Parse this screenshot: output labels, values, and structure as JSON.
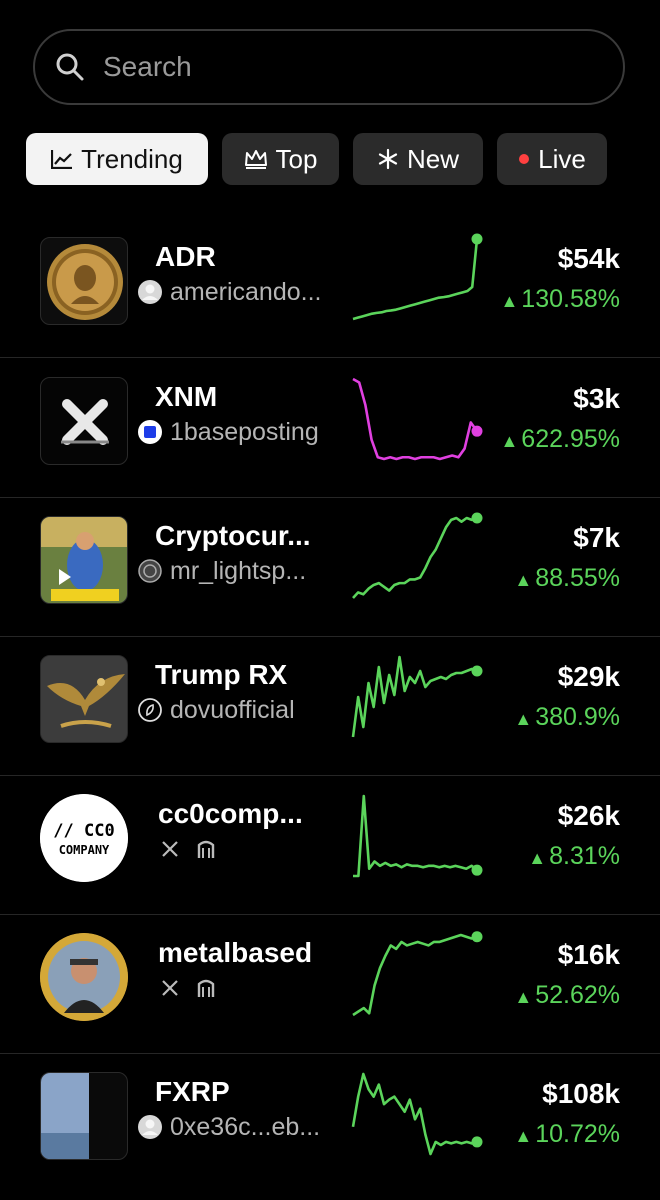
{
  "search": {
    "placeholder": "Search"
  },
  "tabs": [
    {
      "label": "Trending",
      "icon": "trending-chart-icon",
      "active": true
    },
    {
      "label": "Top",
      "icon": "crown-icon",
      "active": false
    },
    {
      "label": "New",
      "icon": "asterisk-icon",
      "active": false
    },
    {
      "label": "Live",
      "icon": "live-dot-icon",
      "active": false,
      "dot_color": "#ff4040"
    }
  ],
  "colors": {
    "up": "#5bd45b",
    "accent_pink": "#e040e0",
    "tab_bg": "#2b2b2b"
  },
  "tokens": [
    {
      "name": "ADR",
      "creator": "americando...",
      "creator_icon": "avatar-placeholder-icon",
      "price": "$54k",
      "change": "130.58%",
      "spark_color": "#5bd45b",
      "spark": [
        10,
        10.5,
        11,
        11.5,
        12,
        12.3,
        12.5,
        13,
        13.2,
        13.5,
        14,
        14.5,
        15,
        15.5,
        16,
        16.5,
        17,
        17.5,
        18,
        18.2,
        18.5,
        19,
        19.5,
        20,
        20.5,
        22,
        40
      ]
    },
    {
      "name": "XNM",
      "creator": "1baseposting",
      "creator_icon": "blue-square-icon",
      "price": "$3k",
      "change": "622.95%",
      "spark_color": "#e040e0",
      "spark": [
        60,
        58,
        45,
        25,
        15,
        14,
        15,
        14,
        15,
        15,
        14,
        15,
        15,
        15,
        14,
        15,
        16,
        15,
        20,
        35,
        30
      ]
    },
    {
      "name": "Cryptocur...",
      "creator": "mr_lightsp...",
      "creator_icon": "coin-icon",
      "price": "$7k",
      "change": "88.55%",
      "spark_color": "#5bd45b",
      "spark": [
        12,
        15,
        14,
        17,
        19,
        20,
        18,
        16,
        19,
        20,
        20,
        22,
        22,
        23,
        28,
        34,
        38,
        44,
        50,
        54,
        55,
        53,
        55,
        54,
        55
      ]
    },
    {
      "name": "Trump RX",
      "creator": "dovuofficial",
      "creator_icon": "leaf-icon",
      "price": "$29k",
      "change": "380.9%",
      "spark_color": "#5bd45b",
      "spark": [
        5,
        25,
        10,
        32,
        20,
        40,
        22,
        36,
        26,
        45,
        28,
        35,
        32,
        38,
        30,
        33,
        34,
        35,
        34,
        36,
        37,
        37,
        38,
        39,
        38
      ]
    },
    {
      "name": "cc0comp...",
      "creator_icon": "x-icon",
      "second_icon": "gate-icon",
      "price": "$26k",
      "change": "8.31%",
      "spark_color": "#5bd45b",
      "spark": [
        5,
        5,
        60,
        10,
        15,
        12,
        14,
        12,
        13,
        11,
        13,
        12,
        12,
        11,
        12,
        12,
        11,
        12,
        11,
        12,
        11,
        10,
        12,
        9
      ]
    },
    {
      "name": "metalbased",
      "creator_icon": "x-icon",
      "second_icon": "gate-icon",
      "price": "$16k",
      "change": "52.62%",
      "spark_color": "#5bd45b",
      "spark": [
        8,
        10,
        12,
        9,
        25,
        35,
        42,
        48,
        46,
        50,
        48,
        49,
        50,
        49,
        48,
        50,
        50,
        51,
        52,
        53,
        54,
        53,
        52,
        53
      ]
    },
    {
      "name": "FXRP",
      "creator": "0xe36c...eb...",
      "creator_icon": "avatar-placeholder-icon",
      "price": "$108k",
      "change": "10.72%",
      "spark_color": "#5bd45b",
      "spark": [
        30,
        50,
        65,
        55,
        50,
        58,
        45,
        48,
        50,
        45,
        40,
        48,
        35,
        42,
        25,
        12,
        20,
        18,
        20,
        19,
        20,
        19,
        20,
        19,
        20
      ]
    }
  ]
}
